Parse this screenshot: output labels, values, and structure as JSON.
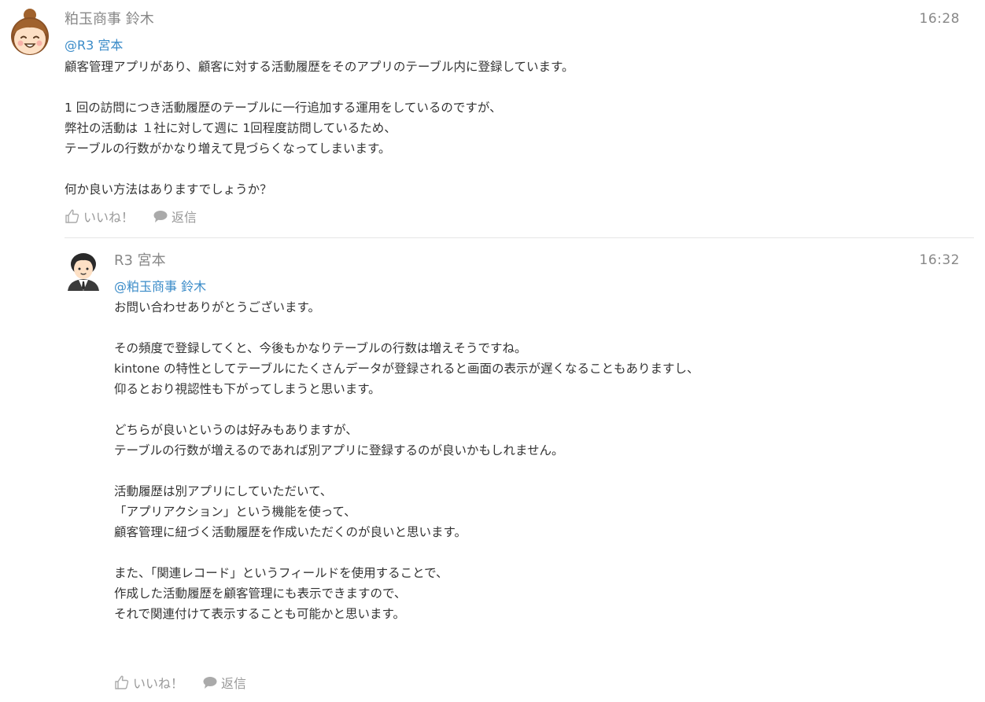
{
  "main_post": {
    "author": "粕玉商事 鈴木",
    "time": "16:28",
    "mention": "@R3 宮本",
    "lines": [
      "顧客管理アプリがあり、顧客に対する活動履歴をそのアプリのテーブル内に登録しています。",
      "",
      "1 回の訪問につき活動履歴のテーブルに一行追加する運用をしているのですが、",
      "弊社の活動は １社に対して週に 1回程度訪問しているため、",
      "テーブルの行数がかなり増えて見づらくなってしまいます。",
      "",
      "何か良い方法はありますでしょうか？"
    ],
    "like_label": "いいね！",
    "reply_label": "返信"
  },
  "reply_post": {
    "author": "R3 宮本",
    "time": "16:32",
    "mention": "@粕玉商事 鈴木",
    "lines": [
      "お問い合わせありがとうございます。",
      "",
      "その頻度で登録してくと、今後もかなりテーブルの行数は増えそうですね。",
      "kintone の特性としてテーブルにたくさんデータが登録されると画面の表示が遅くなることもありますし、",
      "仰るとおり視認性も下がってしまうと思います。",
      "",
      "どちらが良いというのは好みもありますが、",
      "テーブルの行数が増えるのであれば別アプリに登録するのが良いかもしれません。",
      "",
      "活動履歴は別アプリにしていただいて、",
      "「アプリアクション」という機能を使って、",
      "顧客管理に紐づく活動履歴を作成いただくのが良いと思います。",
      "",
      "また、「関連レコード」というフィールドを使用することで、",
      "作成した活動履歴を顧客管理にも表示できますので、",
      "それで関連付けて表示することも可能かと思います。"
    ],
    "like_label": "いいね！",
    "reply_label": "返信"
  },
  "colors": {
    "mention": "#3a8bc8",
    "meta": "#888888",
    "text": "#333333",
    "action": "#999999"
  },
  "icons": {
    "like": "thumbs-up-icon",
    "reply": "speech-bubble-icon"
  }
}
